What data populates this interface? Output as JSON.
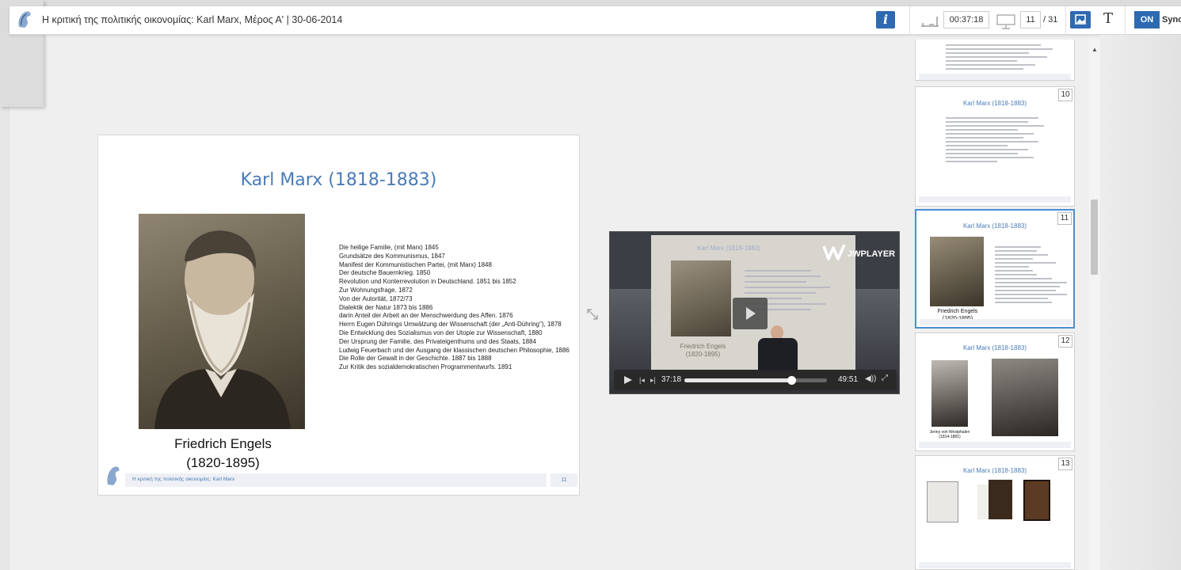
{
  "header": {
    "title": "Η κριτική της πολιτικής οικονομίας: Karl Marx, Μέρος Α' | 30-06-2014",
    "info_label": "i",
    "timer": "00:37:18",
    "current_page": "11",
    "total_pages": "/ 31",
    "text_mode_label": "T",
    "sync_on_label": "ON",
    "sync_label": "Sync"
  },
  "slide": {
    "title": "Karl Marx (1818-1883)",
    "caption_line1": "Friedrich Engels",
    "caption_line2": "(1820-1895)",
    "works": [
      "Die heilige Familie, (mit Marx) 1845",
      "Grundsätze des Kommunismus, 1847",
      "Manifest der Kommunistischen Partei, (mit Marx) 1848",
      "Der deutsche Bauernkrieg. 1850",
      "Revolution und Konterrevolution in Deutschland. 1851 bis 1852",
      "Zur Wohnungsfrage. 1872",
      "Von der Autorität, 1872/73",
      "Dialektik der Natur 1873 bis 1886",
      "darin Anteil der Arbeit an der Menschwerdung des Affen. 1876",
      "Herrn Eugen Dührings Umwälzung der Wissenschaft (der „Anti-Dühring\"), 1878",
      "Die Entwicklung des Sozialismus von der Utopie zur Wissenschaft, 1880",
      "Der Ursprung der Familie, des Privateigenthums und des Staats, 1884",
      "Ludwig Feuerbach und der Ausgang der klassischen deutschen Philosophie, 1886",
      "Die Rolle der Gewalt in der Geschichte. 1887 bis 1888",
      "Zur Kritik des sozialdemokratischen Programmentwurfs. 1891"
    ],
    "footer_text": "Η κριτική της πολιτικής οικονομίας: Karl Marx",
    "footer_number": "11"
  },
  "video": {
    "screen_title": "Karl Marx (1818-1883)",
    "screen_caption_line1": "Friedrich Engels",
    "screen_caption_line2": "(1820-1895)",
    "player_brand": "JWPLAYER",
    "current_time": "37:18",
    "duration": "49:51",
    "progress": 0.748
  },
  "thumbnails": [
    {
      "number": "10",
      "title": "Karl Marx (1818-1883)"
    },
    {
      "number": "11",
      "title": "Karl Marx (1818-1883)",
      "caption_line1": "Friedrich Engels",
      "caption_line2": "(1820-1895)"
    },
    {
      "number": "12",
      "title": "Karl Marx (1818-1883)",
      "caption": "Jenny von Westphalen",
      "caption2": "(1814-1881)"
    },
    {
      "number": "13",
      "title": "Karl Marx (1818-1883)"
    }
  ],
  "colors": {
    "accent": "#2d6ab1",
    "slide_title": "#4a7bb7",
    "active_thumb_border": "#4a8ed8"
  }
}
